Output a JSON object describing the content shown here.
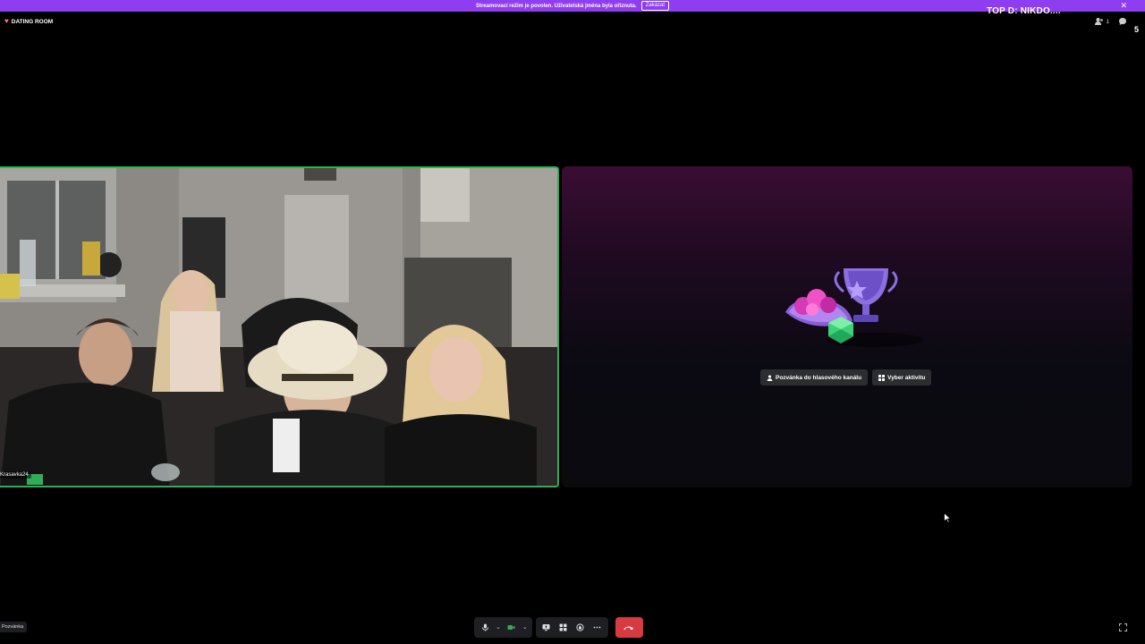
{
  "banner": {
    "text": "Streamovací režim je povolen. Uživatelská jména byla ořiznuta.",
    "button_label": "Zakázat",
    "close_glyph": "✕"
  },
  "overlay": {
    "top_text": "TOP D: NIKDO....",
    "cut_number": "5"
  },
  "channel": {
    "icon": "heart-icon",
    "name": "DATING ROOM"
  },
  "header": {
    "member_count": "1",
    "icons": [
      "members-icon",
      "chat-icon"
    ]
  },
  "video_tile": {
    "username": "Krasavka24",
    "border_color": "#2fae57"
  },
  "activity_tile": {
    "buttons": [
      {
        "label": "Pozvánka do hlasového kanálu",
        "icon": "add-person-icon"
      },
      {
        "label": "Vyber aktivitu",
        "icon": "grid-icon"
      }
    ]
  },
  "bottom_left": {
    "label": "Pozvánka"
  },
  "controls": {
    "items": [
      "microphone-icon",
      "camera-icon",
      "screen-share-icon",
      "activities-icon",
      "soundboard-icon",
      "more-icon",
      "hang-up-icon"
    ],
    "camera_color": "#3ba55c",
    "hangup_color": "#d83a42"
  },
  "colors": {
    "banner": "#8f3df0",
    "background": "#000000",
    "activity_gradient_top": "#3a0d33"
  }
}
